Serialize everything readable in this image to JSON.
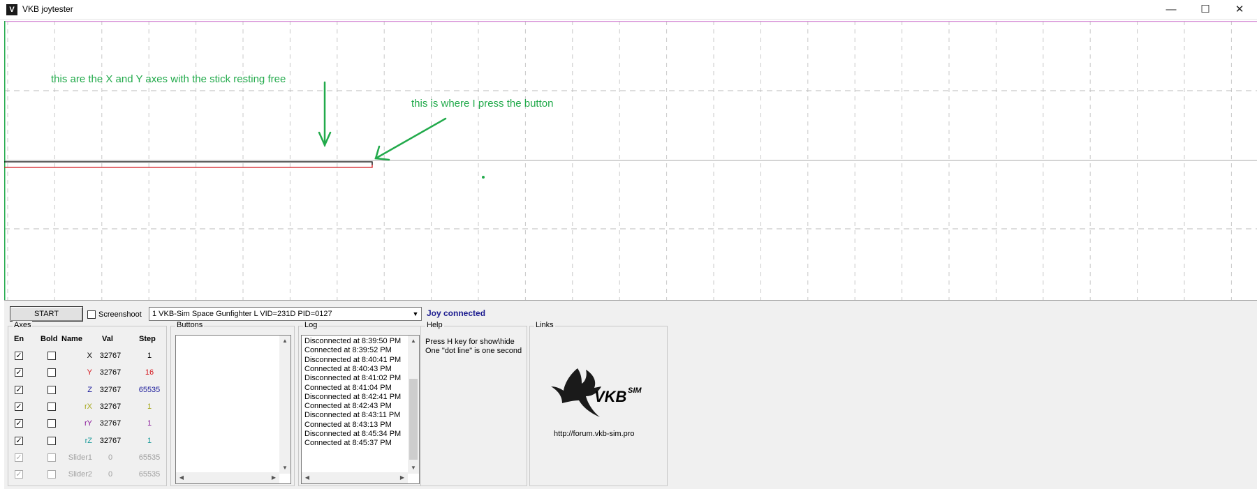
{
  "window": {
    "title": "VKB joytester",
    "icon_letter": "V",
    "controls": {
      "minimize": "—",
      "maximize": "☐",
      "close": "✕"
    }
  },
  "annotations": {
    "axes_note": "this are the X and Y axes with the stick resting free",
    "button_note": "this is where I press the button"
  },
  "toolbar": {
    "start_label": "START",
    "screenshoot_label": "Screenshoot",
    "screenshoot_checked": false,
    "device_selected": "1  VKB-Sim Space Gunfighter L  VID=231D PID=0127",
    "status_text": "Joy connected",
    "status_color": "#1b1b8f"
  },
  "axes": {
    "title": "Axes",
    "headers": {
      "en": "En",
      "bold": "Bold",
      "name": "Name",
      "val": "Val",
      "step": "Step"
    },
    "rows": [
      {
        "name": "X",
        "val": "32767",
        "step": "1",
        "en": true,
        "bold": false,
        "color": "#000000",
        "enabled": true
      },
      {
        "name": "Y",
        "val": "32767",
        "step": "16",
        "en": true,
        "bold": false,
        "color": "#d4161c",
        "enabled": true
      },
      {
        "name": "Z",
        "val": "32767",
        "step": "65535",
        "en": true,
        "bold": false,
        "color": "#1a1a9a",
        "enabled": true
      },
      {
        "name": "rX",
        "val": "32767",
        "step": "1",
        "en": true,
        "bold": false,
        "color": "#a6a81c",
        "enabled": true
      },
      {
        "name": "rY",
        "val": "32767",
        "step": "1",
        "en": true,
        "bold": false,
        "color": "#8a1a9a",
        "enabled": true
      },
      {
        "name": "rZ",
        "val": "32767",
        "step": "1",
        "en": true,
        "bold": false,
        "color": "#1a9a9a",
        "enabled": true
      },
      {
        "name": "Slider1",
        "val": "0",
        "step": "65535",
        "en": true,
        "bold": false,
        "color": "#a0a0a0",
        "enabled": false
      },
      {
        "name": "Slider2",
        "val": "0",
        "step": "65535",
        "en": true,
        "bold": false,
        "color": "#a0a0a0",
        "enabled": false
      }
    ]
  },
  "buttons_group": {
    "title": "Buttons"
  },
  "log": {
    "title": "Log",
    "lines": [
      "Disconnected at 8:39:50 PM",
      "Connected at 8:39:52 PM",
      "Disconnected at 8:40:41 PM",
      "Connected at 8:40:43 PM",
      "Disconnected at 8:41:02 PM",
      "Connected at 8:41:04 PM",
      "Disconnected at 8:42:41 PM",
      "Connected at 8:42:43 PM",
      "Disconnected at 8:43:11 PM",
      "Connected at 8:43:13 PM",
      "Disconnected at 8:45:34 PM",
      "Connected at 8:45:37 PM"
    ]
  },
  "help": {
    "title": "Help",
    "lines": [
      "Press H key for show\\hide",
      "One \"dot line\" is one second"
    ]
  },
  "links": {
    "title": "Links",
    "url": "http://forum.vkb-sim.pro",
    "logo_text": "VKB",
    "logo_sup": "SIM"
  },
  "colors": {
    "annotation": "#22aa4b",
    "grid_top_line": "#d58ad5",
    "axis_red": "#d4161c"
  }
}
